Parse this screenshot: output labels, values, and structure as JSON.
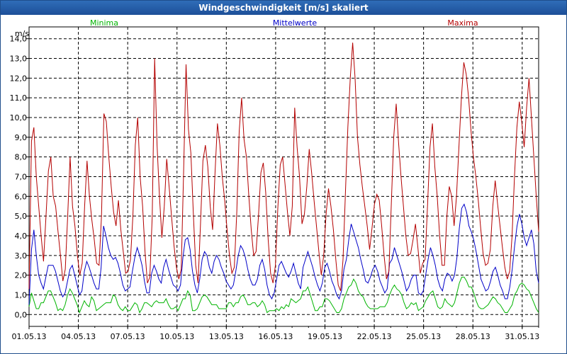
{
  "window": {
    "title": "Windgeschwindigkeit [m/s] skaliert"
  },
  "chart_data": {
    "type": "line",
    "title": "Windgeschwindigkeit [m/s] skaliert",
    "ylabel": "m/s",
    "ylim": [
      -0.6,
      14.6
    ],
    "yticks": [
      "0,0",
      "1,0",
      "2,0",
      "3,0",
      "4,0",
      "5,0",
      "6,0",
      "7,0",
      "8,0",
      "9,0",
      "10,0",
      "11,0",
      "12,0",
      "13,0",
      "14,0"
    ],
    "xticks": [
      "01.05.13",
      "04.05.13",
      "07.05.13",
      "10.05.13",
      "13.05.13",
      "16.05.13",
      "19.05.13",
      "22.05.13",
      "25.05.13",
      "28.05.13",
      "31.05.13"
    ],
    "x_day_range": [
      1,
      32
    ],
    "grid": true,
    "legend": [
      "Minima",
      "Mittelwerte",
      "Maxima"
    ],
    "series": [
      {
        "name": "Minima",
        "color": "#00b400",
        "values": [
          0.4,
          1.1,
          0.7,
          0.3,
          0.3,
          0.6,
          0.6,
          0.9,
          1.2,
          1.2,
          0.9,
          0.6,
          0.2,
          0.3,
          0.2,
          0.5,
          1.0,
          1.3,
          1.1,
          0.8,
          0.5,
          0.1,
          0.4,
          0.7,
          0.5,
          0.4,
          0.9,
          0.7,
          0.2,
          0.3,
          0.4,
          0.5,
          0.6,
          0.6,
          0.6,
          1.0,
          0.9,
          0.5,
          0.3,
          0.2,
          0.4,
          0.2,
          0.2,
          0.4,
          0.6,
          0.5,
          0.1,
          0.3,
          0.6,
          0.6,
          0.5,
          0.4,
          0.6,
          0.7,
          0.6,
          0.6,
          0.6,
          0.8,
          0.5,
          0.3,
          0.3,
          0.4,
          0.2,
          0.5,
          0.8,
          0.8,
          1.2,
          1.0,
          0.2,
          0.2,
          0.3,
          0.6,
          0.9,
          1.0,
          0.9,
          0.7,
          0.5,
          0.5,
          0.5,
          0.3,
          0.3,
          0.3,
          0.3,
          0.6,
          0.6,
          0.4,
          0.6,
          0.6,
          0.9,
          1.0,
          0.8,
          0.5,
          0.5,
          0.6,
          0.6,
          0.4,
          0.5,
          0.7,
          0.5,
          0.1,
          0.2,
          0.2,
          0.2,
          0.3,
          0.2,
          0.4,
          0.3,
          0.5,
          0.4,
          0.8,
          0.7,
          0.6,
          0.7,
          0.8,
          1.2,
          1.2,
          1.4,
          1.0,
          0.6,
          0.2,
          0.2,
          0.4,
          0.4,
          0.8,
          0.8,
          0.7,
          0.5,
          0.3,
          0.1,
          0.1,
          0.3,
          0.8,
          1.1,
          1.4,
          1.5,
          1.8,
          1.6,
          1.2,
          1.0,
          0.9,
          0.6,
          0.4,
          0.3,
          0.3,
          0.3,
          0.3,
          0.4,
          0.4,
          0.4,
          0.6,
          1.0,
          1.3,
          1.5,
          1.3,
          1.2,
          1.0,
          0.6,
          0.3,
          0.4,
          0.6,
          0.5,
          0.6,
          0.2,
          0.3,
          0.4,
          0.7,
          0.9,
          1.1,
          1.2,
          0.8,
          0.4,
          0.3,
          0.4,
          0.8,
          0.6,
          0.5,
          0.4,
          0.6,
          1.1,
          1.6,
          1.9,
          1.9,
          1.7,
          1.4,
          1.4,
          1.1,
          0.7,
          0.4,
          0.3,
          0.3,
          0.4,
          0.5,
          0.7,
          0.9,
          0.8,
          0.6,
          0.5,
          0.3,
          0.1,
          0.1,
          0.3,
          0.5,
          1.0,
          1.2,
          1.5,
          1.6,
          1.5,
          1.3,
          1.2,
          0.9,
          0.6,
          0.3,
          0.1
        ]
      },
      {
        "name": "Mittelwerte",
        "color": "#0000c8",
        "values": [
          0.5,
          3.3,
          4.3,
          3.0,
          2.0,
          1.6,
          1.3,
          1.9,
          2.5,
          2.5,
          2.5,
          2.2,
          1.7,
          1.2,
          0.9,
          1.1,
          1.7,
          2.3,
          2.5,
          2.0,
          1.5,
          1.0,
          1.2,
          2.2,
          2.7,
          2.4,
          2.0,
          1.6,
          1.3,
          1.3,
          2.4,
          4.5,
          4.0,
          3.4,
          3.0,
          2.8,
          2.9,
          2.6,
          2.1,
          1.5,
          1.2,
          1.3,
          1.4,
          2.2,
          2.9,
          3.4,
          3.0,
          2.5,
          1.7,
          1.1,
          1.1,
          2.1,
          2.5,
          2.2,
          1.8,
          1.6,
          2.4,
          2.8,
          2.3,
          1.9,
          1.5,
          1.4,
          1.2,
          1.5,
          2.9,
          3.8,
          3.9,
          3.3,
          2.2,
          1.5,
          1.1,
          1.8,
          2.8,
          3.2,
          3.0,
          2.4,
          2.1,
          2.7,
          3.0,
          2.8,
          2.4,
          2.1,
          1.7,
          1.5,
          1.3,
          1.5,
          2.2,
          3.0,
          3.5,
          3.3,
          2.9,
          2.3,
          1.8,
          1.5,
          1.5,
          1.8,
          2.5,
          2.8,
          2.3,
          1.5,
          1.0,
          0.8,
          1.1,
          1.8,
          2.5,
          2.7,
          2.4,
          2.1,
          1.9,
          2.2,
          2.6,
          2.1,
          1.6,
          1.3,
          2.4,
          2.8,
          3.2,
          2.8,
          2.4,
          1.9,
          1.5,
          1.2,
          1.6,
          2.4,
          2.6,
          2.2,
          1.7,
          1.4,
          1.0,
          0.8,
          1.2,
          2.3,
          2.8,
          3.8,
          4.6,
          4.2,
          3.8,
          3.4,
          2.8,
          2.3,
          1.7,
          1.6,
          1.9,
          2.3,
          2.5,
          2.2,
          1.7,
          1.4,
          1.1,
          1.3,
          2.6,
          2.8,
          3.4,
          3.0,
          2.6,
          2.2,
          1.7,
          1.2,
          1.4,
          1.8,
          2.0,
          2.0,
          1.1,
          1.0,
          1.2,
          2.0,
          2.8,
          3.4,
          3.0,
          2.5,
          1.8,
          1.4,
          1.2,
          1.8,
          2.1,
          2.0,
          1.7,
          2.0,
          2.9,
          4.4,
          5.4,
          5.6,
          5.2,
          4.5,
          4.2,
          3.8,
          3.2,
          2.5,
          1.8,
          1.5,
          1.2,
          1.3,
          1.7,
          2.2,
          2.4,
          2.0,
          1.5,
          1.2,
          0.8,
          0.8,
          1.4,
          2.3,
          3.5,
          4.5,
          5.1,
          4.6,
          3.9,
          3.5,
          3.9,
          4.3,
          3.6,
          2.2,
          1.6
        ]
      },
      {
        "name": "Maxima",
        "color": "#b40000",
        "values": [
          1.3,
          8.8,
          9.5,
          7.0,
          5.5,
          4.0,
          2.7,
          5.0,
          7.3,
          8.0,
          6.0,
          5.5,
          4.2,
          3.0,
          1.7,
          2.3,
          5.0,
          8.0,
          5.5,
          4.5,
          3.0,
          2.0,
          2.6,
          5.5,
          7.8,
          6.0,
          4.8,
          3.8,
          2.6,
          2.5,
          5.0,
          10.2,
          9.8,
          8.0,
          6.5,
          5.2,
          4.5,
          5.8,
          4.3,
          3.2,
          2.1,
          2.2,
          2.8,
          5.0,
          8.6,
          10.0,
          7.0,
          5.5,
          3.2,
          1.6,
          1.9,
          5.0,
          13.0,
          8.6,
          6.0,
          3.9,
          5.5,
          7.9,
          6.5,
          5.0,
          3.5,
          2.4,
          1.8,
          2.3,
          7.3,
          12.7,
          9.4,
          8.2,
          5.2,
          2.5,
          1.6,
          4.6,
          7.8,
          8.6,
          7.5,
          5.5,
          4.3,
          7.2,
          9.7,
          8.6,
          7.0,
          5.8,
          4.3,
          3.0,
          2.1,
          2.4,
          5.2,
          9.3,
          11.0,
          8.9,
          8.0,
          6.0,
          4.3,
          3.0,
          3.2,
          5.0,
          7.2,
          7.7,
          6.2,
          3.8,
          2.1,
          1.6,
          2.5,
          5.4,
          7.6,
          8.0,
          6.6,
          5.2,
          4.0,
          5.5,
          10.5,
          8.5,
          7.0,
          4.6,
          5.1,
          6.5,
          8.4,
          7.2,
          5.8,
          4.5,
          3.2,
          2.0,
          3.0,
          5.1,
          6.4,
          5.5,
          4.3,
          2.8,
          1.5,
          1.2,
          2.8,
          6.2,
          9.5,
          12.0,
          13.8,
          12.0,
          9.0,
          7.6,
          6.5,
          5.5,
          4.5,
          3.3,
          4.4,
          5.6,
          6.1,
          5.8,
          4.5,
          3.0,
          1.8,
          2.2,
          5.6,
          9.0,
          10.7,
          8.7,
          7.0,
          5.5,
          4.0,
          3.0,
          3.1,
          3.8,
          4.6,
          3.4,
          2.1,
          2.6,
          2.8,
          5.6,
          8.5,
          9.7,
          7.5,
          6.0,
          4.0,
          2.5,
          2.5,
          5.0,
          6.5,
          6.0,
          4.5,
          6.0,
          8.5,
          11.0,
          12.8,
          12.2,
          11.0,
          9.3,
          8.0,
          7.0,
          5.8,
          4.4,
          3.1,
          2.5,
          2.6,
          3.3,
          5.5,
          6.8,
          5.6,
          4.5,
          3.4,
          2.4,
          1.8,
          2.2,
          4.0,
          7.0,
          9.5,
          10.8,
          9.8,
          8.5,
          10.5,
          12.0,
          10.0,
          8.0,
          6.0,
          4.2
        ]
      }
    ]
  }
}
